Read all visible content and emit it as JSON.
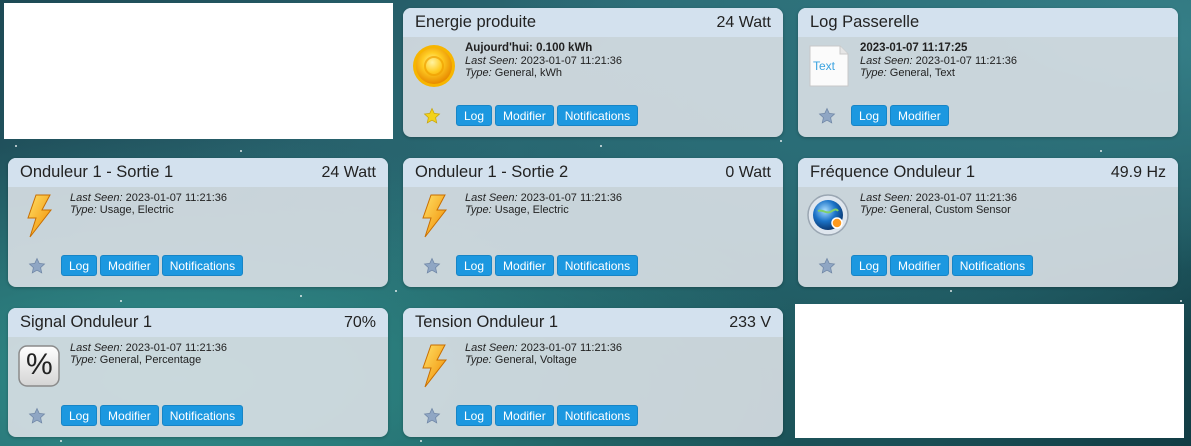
{
  "cards": {
    "energie": {
      "title": "Energie produite",
      "value": "24 Watt",
      "main": "Aujourd'hui: 0.100 kWh",
      "last_seen_label": "Last Seen:",
      "last_seen": "2023-01-07 11:21:36",
      "type_label": "Type:",
      "type": "General, kWh",
      "icon": "sun-icon",
      "favorite": true,
      "buttons": [
        "Log",
        "Modifier",
        "Notifications"
      ]
    },
    "log_passerelle": {
      "title": "Log Passerelle",
      "value": "",
      "main": "2023-01-07 11:17:25",
      "last_seen_label": "Last Seen:",
      "last_seen": "2023-01-07 11:21:36",
      "type_label": "Type:",
      "type": "General, Text",
      "icon": "text-icon",
      "icon_text": "Text",
      "favorite": false,
      "buttons": [
        "Log",
        "Modifier"
      ]
    },
    "sortie1": {
      "title": "Onduleur 1 - Sortie 1",
      "value": "24 Watt",
      "last_seen_label": "Last Seen:",
      "last_seen": "2023-01-07 11:21:36",
      "type_label": "Type:",
      "type": "Usage, Electric",
      "icon": "lightning-icon",
      "favorite": false,
      "buttons": [
        "Log",
        "Modifier",
        "Notifications"
      ]
    },
    "sortie2": {
      "title": "Onduleur 1 - Sortie 2",
      "value": "0 Watt",
      "last_seen_label": "Last Seen:",
      "last_seen": "2023-01-07 11:21:36",
      "type_label": "Type:",
      "type": "Usage, Electric",
      "icon": "lightning-icon",
      "favorite": false,
      "buttons": [
        "Log",
        "Modifier",
        "Notifications"
      ]
    },
    "frequence": {
      "title": "Fréquence Onduleur 1",
      "value": "49.9 Hz",
      "last_seen_label": "Last Seen:",
      "last_seen": "2023-01-07 11:21:36",
      "type_label": "Type:",
      "type": "General, Custom Sensor",
      "icon": "globe-sensor-icon",
      "favorite": false,
      "buttons": [
        "Log",
        "Modifier",
        "Notifications"
      ]
    },
    "signal": {
      "title": "Signal Onduleur 1",
      "value": "70%",
      "last_seen_label": "Last Seen:",
      "last_seen": "2023-01-07 11:21:36",
      "type_label": "Type:",
      "type": "General, Percentage",
      "icon": "percent-icon",
      "icon_text": "%",
      "favorite": false,
      "buttons": [
        "Log",
        "Modifier",
        "Notifications"
      ]
    },
    "tension": {
      "title": "Tension Onduleur 1",
      "value": "233 V",
      "last_seen_label": "Last Seen:",
      "last_seen": "2023-01-07 11:21:36",
      "type_label": "Type:",
      "type": "General, Voltage",
      "icon": "lightning-icon",
      "favorite": false,
      "buttons": [
        "Log",
        "Modifier",
        "Notifications"
      ]
    }
  },
  "colors": {
    "header_bg": "#d3e1ee",
    "button_bg": "#1c98e0",
    "favorite_star": "#f2d21b",
    "inactive_star": "#8fa6c4"
  }
}
